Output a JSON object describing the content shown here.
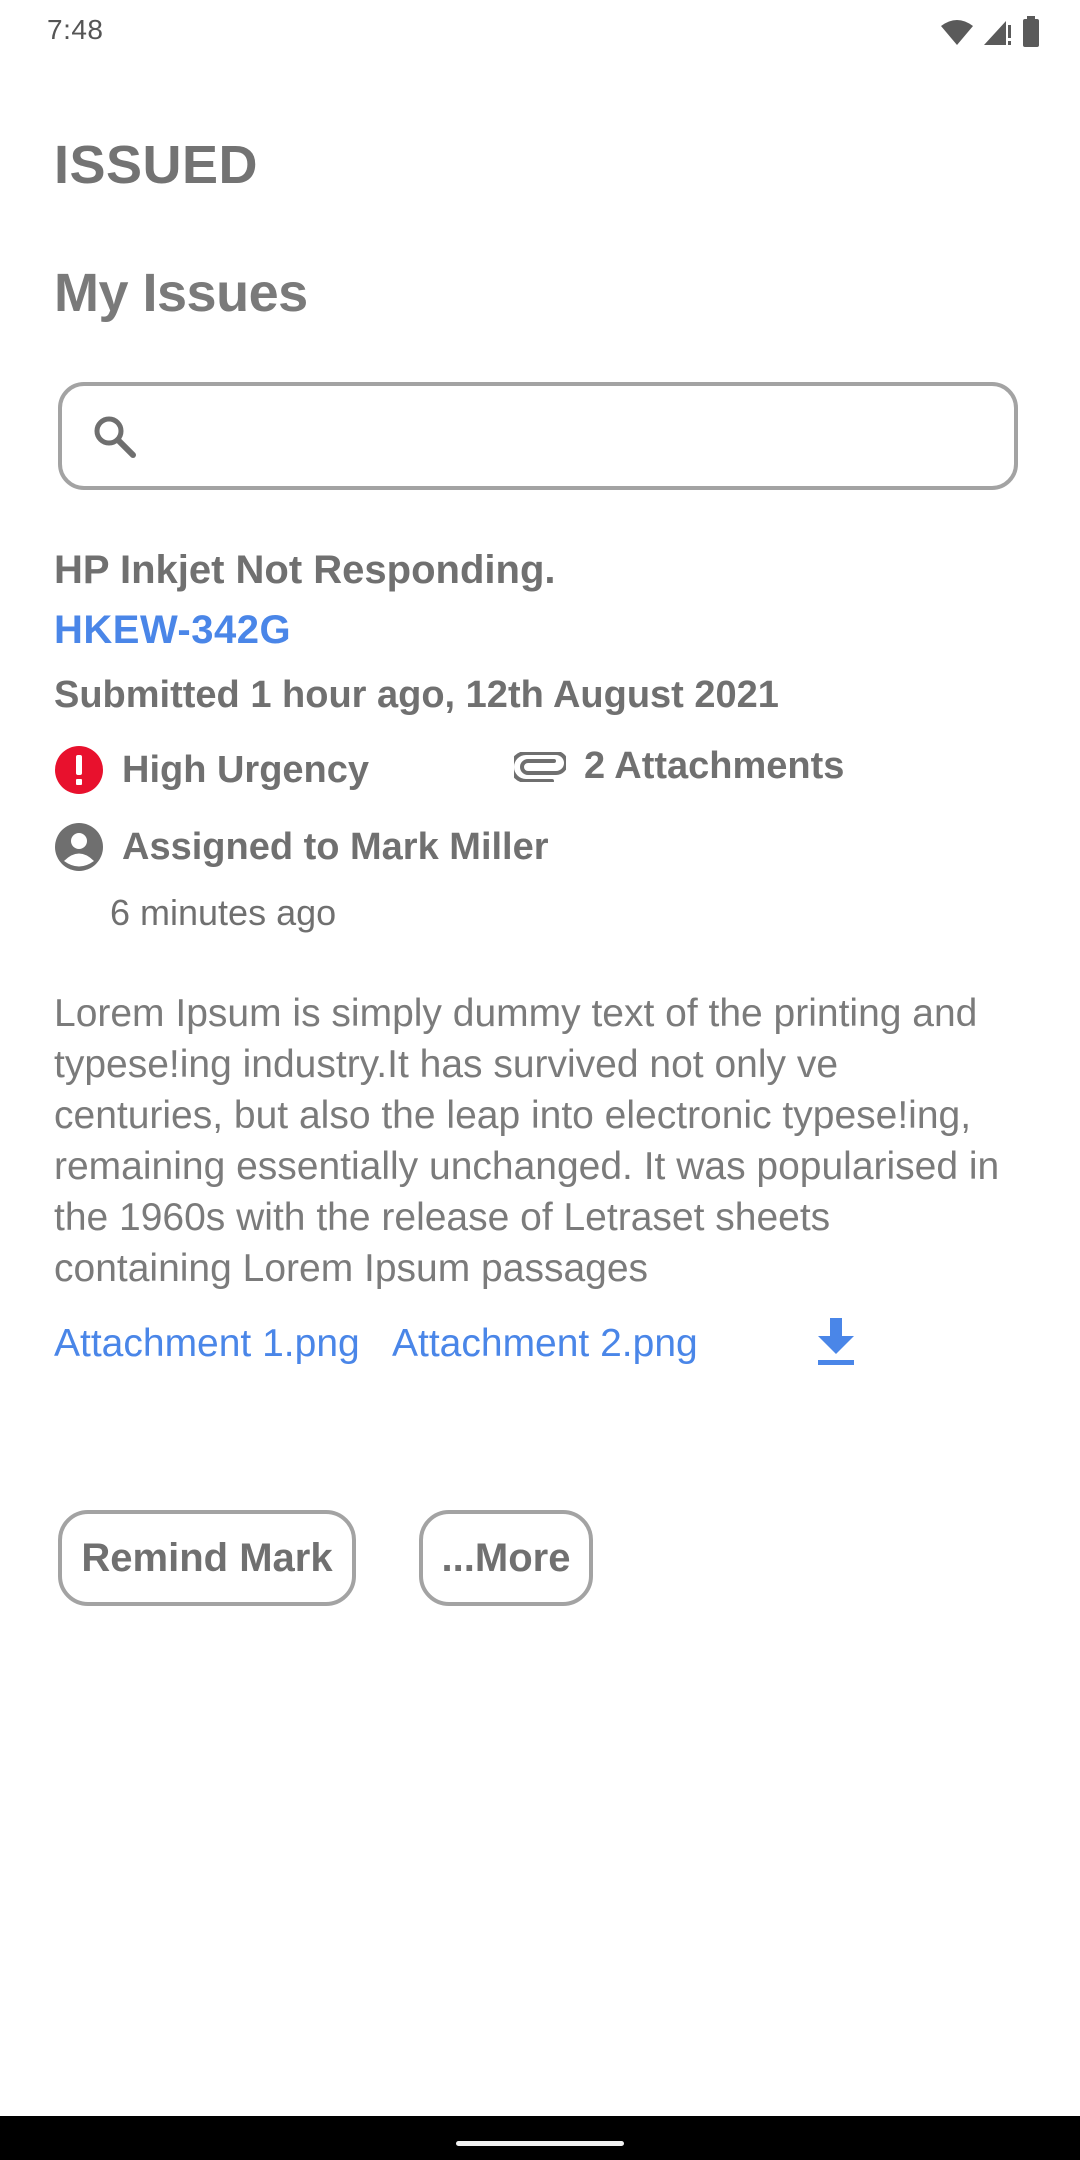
{
  "status_bar": {
    "time": "7:48",
    "icons": [
      "wifi-icon",
      "cell-signal-icon",
      "battery-icon"
    ]
  },
  "header": {
    "app_title": "ISSUED",
    "section_title": "My Issues"
  },
  "search": {
    "icon": "search-icon",
    "value": "",
    "placeholder": ""
  },
  "issue": {
    "title": "HP Inkjet Not Responding.",
    "id": "HKEW-342G",
    "submitted": "Submitted 1 hour ago, 12th August 2021",
    "urgency": {
      "icon": "alert-icon",
      "label": "High Urgency",
      "color": "#e8112d"
    },
    "attachments_summary": {
      "icon": "paperclip-icon",
      "label": "2 Attachments"
    },
    "assigned": {
      "icon": "account-circle-icon",
      "label": "Assigned to Mark Miller",
      "time": "6 minutes ago"
    },
    "description": "Lorem Ipsum is simply dummy text of the printing and typese!ing industry.It has survived not only ve centuries, but also the leap into electronic typese!ing, remaining essentially unchanged. It was popularised in the 1960s with the release of Letraset sheets containing Lorem Ipsum passages",
    "attachments": [
      {
        "label": "Attachment 1.png"
      },
      {
        "label": "Attachment 2.png"
      }
    ],
    "download_icon": "download-icon"
  },
  "actions": {
    "remind_label": "Remind Mark",
    "more_label": "...More"
  },
  "colors": {
    "link": "#4a86e8",
    "text": "#707070",
    "border": "#a3a3a3",
    "urgent": "#e8112d"
  }
}
